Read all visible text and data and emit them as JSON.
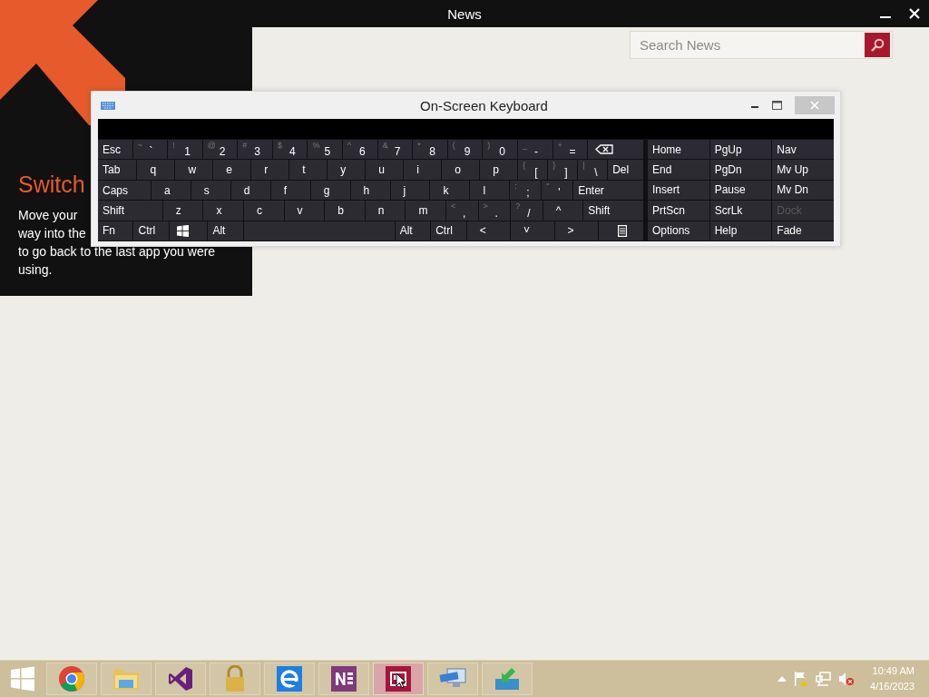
{
  "app": {
    "title": "News",
    "search": {
      "placeholder": "Search News"
    }
  },
  "tip": {
    "title": "Switch",
    "lines": [
      "Move your",
      "way into the",
      "to go back to the last app you were",
      "using."
    ]
  },
  "keyboard": {
    "title": "On-Screen Keyboard",
    "main_rows": [
      [
        {
          "kind": "text",
          "label": "Esc"
        },
        {
          "kind": "dual",
          "shift": "~",
          "label": "`"
        },
        {
          "kind": "dual",
          "shift": "!",
          "label": "1"
        },
        {
          "kind": "dual",
          "shift": "@",
          "label": "2"
        },
        {
          "kind": "dual",
          "shift": "#",
          "label": "3"
        },
        {
          "kind": "dual",
          "shift": "$",
          "label": "4"
        },
        {
          "kind": "dual",
          "shift": "%",
          "label": "5"
        },
        {
          "kind": "dual",
          "shift": "^",
          "label": "6"
        },
        {
          "kind": "dual",
          "shift": "&",
          "label": "7"
        },
        {
          "kind": "dual",
          "shift": "*",
          "label": "8"
        },
        {
          "kind": "dual",
          "shift": "(",
          "label": "9"
        },
        {
          "kind": "dual",
          "shift": ")",
          "label": "0"
        },
        {
          "kind": "dual",
          "shift": "_",
          "label": "-"
        },
        {
          "kind": "dual",
          "shift": "+",
          "label": "="
        },
        {
          "kind": "backspace"
        }
      ],
      [
        {
          "kind": "text",
          "label": "Tab"
        },
        {
          "kind": "letter",
          "label": "q"
        },
        {
          "kind": "letter",
          "label": "w"
        },
        {
          "kind": "letter",
          "label": "e"
        },
        {
          "kind": "letter",
          "label": "r"
        },
        {
          "kind": "letter",
          "label": "t"
        },
        {
          "kind": "letter",
          "label": "y"
        },
        {
          "kind": "letter",
          "label": "u"
        },
        {
          "kind": "letter",
          "label": "i"
        },
        {
          "kind": "letter",
          "label": "o"
        },
        {
          "kind": "letter",
          "label": "p"
        },
        {
          "kind": "dual",
          "shift": "{",
          "label": "["
        },
        {
          "kind": "dual",
          "shift": "}",
          "label": "]"
        },
        {
          "kind": "dual",
          "shift": "|",
          "label": "\\"
        },
        {
          "kind": "text",
          "label": "Del"
        }
      ],
      [
        {
          "kind": "text",
          "label": "Caps"
        },
        {
          "kind": "letter",
          "label": "a"
        },
        {
          "kind": "letter",
          "label": "s"
        },
        {
          "kind": "letter",
          "label": "d"
        },
        {
          "kind": "letter",
          "label": "f"
        },
        {
          "kind": "letter",
          "label": "g"
        },
        {
          "kind": "letter",
          "label": "h"
        },
        {
          "kind": "letter",
          "label": "j"
        },
        {
          "kind": "letter",
          "label": "k"
        },
        {
          "kind": "letter",
          "label": "l"
        },
        {
          "kind": "dual",
          "shift": ":",
          "label": ";"
        },
        {
          "kind": "dual",
          "shift": "\"",
          "label": "'"
        },
        {
          "kind": "text",
          "label": "Enter"
        }
      ],
      [
        {
          "kind": "text",
          "label": "Shift"
        },
        {
          "kind": "letter",
          "label": "z"
        },
        {
          "kind": "letter",
          "label": "x"
        },
        {
          "kind": "letter",
          "label": "c"
        },
        {
          "kind": "letter",
          "label": "v"
        },
        {
          "kind": "letter",
          "label": "b"
        },
        {
          "kind": "letter",
          "label": "n"
        },
        {
          "kind": "letter",
          "label": "m"
        },
        {
          "kind": "dual",
          "shift": "<",
          "label": ","
        },
        {
          "kind": "dual",
          "shift": ">",
          "label": "."
        },
        {
          "kind": "dual",
          "shift": "?",
          "label": "/"
        },
        {
          "kind": "letter",
          "label": "^"
        },
        {
          "kind": "text",
          "label": "Shift"
        }
      ],
      [
        {
          "kind": "text",
          "label": "Fn"
        },
        {
          "kind": "text",
          "label": "Ctrl"
        },
        {
          "kind": "windows"
        },
        {
          "kind": "text",
          "label": "Alt"
        },
        {
          "kind": "space"
        },
        {
          "kind": "text",
          "label": "Alt"
        },
        {
          "kind": "text",
          "label": "Ctrl"
        },
        {
          "kind": "letter",
          "label": "<"
        },
        {
          "kind": "letter",
          "label": "˅"
        },
        {
          "kind": "letter",
          "label": ">"
        },
        {
          "kind": "menu"
        }
      ]
    ],
    "nav_keys": [
      {
        "label": "Home",
        "disabled": false
      },
      {
        "label": "PgUp",
        "disabled": false
      },
      {
        "label": "Nav",
        "disabled": false
      },
      {
        "label": "End",
        "disabled": false
      },
      {
        "label": "PgDn",
        "disabled": false
      },
      {
        "label": "Mv Up",
        "disabled": false
      },
      {
        "label": "Insert",
        "disabled": false
      },
      {
        "label": "Pause",
        "disabled": false
      },
      {
        "label": "Mv Dn",
        "disabled": false
      },
      {
        "label": "PrtScn",
        "disabled": false
      },
      {
        "label": "ScrLk",
        "disabled": false
      },
      {
        "label": "Dock",
        "disabled": true
      },
      {
        "label": "Options",
        "disabled": false
      },
      {
        "label": "Help",
        "disabled": false
      },
      {
        "label": "Fade",
        "disabled": false
      }
    ]
  },
  "taskbar": {
    "apps": [
      {
        "kind": "chrome",
        "selected": false
      },
      {
        "kind": "folder",
        "selected": false
      },
      {
        "kind": "vs",
        "selected": false
      },
      {
        "kind": "lock",
        "selected": false
      },
      {
        "kind": "ie",
        "selected": false
      },
      {
        "kind": "onenote",
        "selected": false
      },
      {
        "kind": "news",
        "selected": true
      },
      {
        "kind": "keyboard",
        "selected": false
      },
      {
        "kind": "download",
        "selected": false
      }
    ],
    "clock": {
      "time": "10:49 AM",
      "date": "4/16/2023"
    }
  }
}
